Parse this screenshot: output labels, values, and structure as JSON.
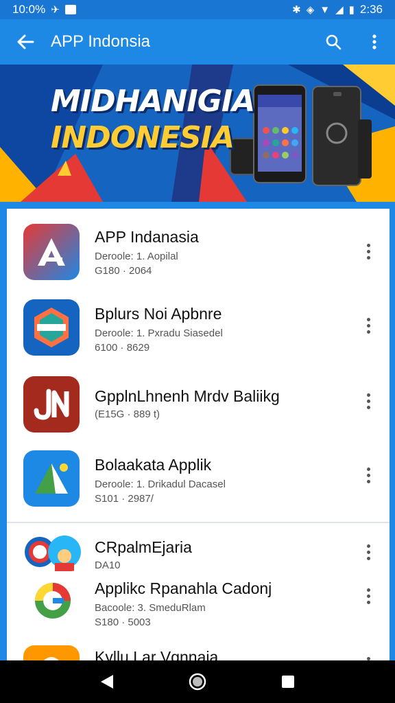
{
  "status_bar": {
    "time_left": "10:0%",
    "time_right": "2:36",
    "icons": [
      "notification-icon",
      "mail-icon",
      "bluetooth-icon",
      "vibrate-icon",
      "wifi-icon",
      "signal-icon",
      "battery-icon"
    ]
  },
  "app_bar": {
    "title": "APP Indonsia",
    "back_icon": "arrow-left-icon",
    "search_icon": "search-icon",
    "menu_icon": "more-vert-icon"
  },
  "banner": {
    "line1": "MIDHANIGIA",
    "line2": "INDONESIA",
    "colors": {
      "blue": "#1565c0",
      "yellow": "#ffcc33",
      "red": "#e53935"
    }
  },
  "apps": [
    {
      "name": "APP Indanasia",
      "subtitle": "Deroole: 1. Aopilal",
      "meta": "G180 · 2064",
      "icon": "letter-a-icon"
    },
    {
      "name": "Bplurs Noi Apbnre",
      "subtitle": "Deroole: 1. Pxradu Siasedel",
      "meta": "6100 · 8629",
      "icon": "hexagon-logo-icon"
    },
    {
      "name": "GpplnLhnenh Mrdv Baliikg",
      "subtitle": "",
      "meta": "(E15G · 889 t)",
      "icon": "letter-jn-icon"
    },
    {
      "name": "Bolaakata Applik",
      "subtitle": "Deroole: 1. Drikadul Dacasel",
      "meta": "S101 · 2987/",
      "icon": "triangle-a-icon"
    },
    {
      "name": "CRpalmEjaria",
      "subtitle": "",
      "meta": "DA10",
      "icon": "avatar-group-icon"
    },
    {
      "name": "Applikc Rpanahla Cadonj",
      "subtitle": "Bacoole: 3. SmeduRlam",
      "meta": "S180 · 5003",
      "icon": "letter-g-icon"
    },
    {
      "name": "Kyllu Lar Vgnnaia",
      "subtitle": "",
      "meta": "",
      "icon": "orange-app-icon"
    }
  ],
  "nav_bar": {
    "back_icon": "triangle-back-icon",
    "home_icon": "circle-home-icon",
    "recents_icon": "square-recents-icon"
  }
}
